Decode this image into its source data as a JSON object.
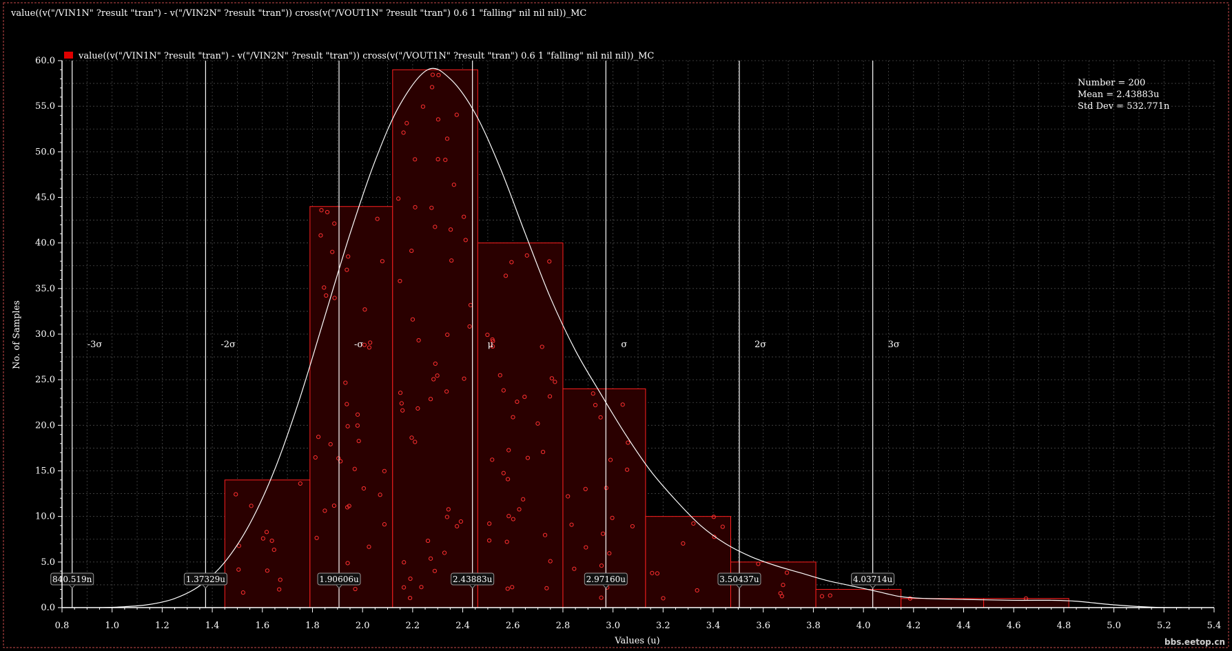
{
  "window": {
    "title": "value((v(\"/VIN1N\" ?result \"tran\") - v(\"/VIN2N\" ?result \"tran\")) cross(v(\"/VOUT1N\" ?result \"tran\") 0.6 1 \"falling\" nil nil nil))_MC"
  },
  "watermark": "bbs.eetop.cn",
  "colors": {
    "background": "#000000",
    "bar_fill": "#2a0000",
    "bar_stroke": "#ff2020",
    "dot": "#ff3030",
    "curve": "#ffffff",
    "grid": "#4a4a4a",
    "frame_dash": "#c84a4a"
  },
  "stats": {
    "number": "Number = 200",
    "mean": "Mean = 2.43883u",
    "std": "Std Dev = 532.771n"
  },
  "chart_data": {
    "type": "bar",
    "legend": "value((v(\"/VIN1N\" ?result \"tran\") - v(\"/VIN2N\" ?result \"tran\")) cross(v(\"/VOUT1N\" ?result \"tran\") 0.6 1 \"falling\" nil nil nil))_MC",
    "xlabel": "Values (u)",
    "ylabel": "No. of Samples",
    "xlim": [
      0.75,
      5.4
    ],
    "ylim": [
      0,
      60
    ],
    "xticks": [
      "0.8",
      "1.0",
      "1.2",
      "1.4",
      "1.6",
      "1.8",
      "2.0",
      "2.2",
      "2.4",
      "2.6",
      "2.8",
      "3.0",
      "3.2",
      "3.4",
      "3.6",
      "3.8",
      "4.0",
      "4.2",
      "4.4",
      "4.6",
      "4.8",
      "5.0",
      "5.2",
      "5.4"
    ],
    "yticks": [
      "0.0",
      "5.0",
      "10.0",
      "15.0",
      "20.0",
      "25.0",
      "30.0",
      "35.0",
      "40.0",
      "45.0",
      "50.0",
      "55.0",
      "60.0"
    ],
    "grid": true,
    "legend_position": "top-left",
    "bins": [
      {
        "x0": 1.45,
        "x1": 1.79,
        "count": 14
      },
      {
        "x0": 1.79,
        "x1": 2.12,
        "count": 44
      },
      {
        "x0": 2.12,
        "x1": 2.46,
        "count": 59
      },
      {
        "x0": 2.46,
        "x1": 2.8,
        "count": 40
      },
      {
        "x0": 2.8,
        "x1": 3.13,
        "count": 24
      },
      {
        "x0": 3.13,
        "x1": 3.47,
        "count": 10
      },
      {
        "x0": 3.47,
        "x1": 3.81,
        "count": 5
      },
      {
        "x0": 3.81,
        "x1": 4.15,
        "count": 2
      },
      {
        "x0": 4.15,
        "x1": 4.48,
        "count": 1
      },
      {
        "x0": 4.48,
        "x1": 4.82,
        "count": 1
      }
    ],
    "density_curve": [
      [
        0.95,
        0.0
      ],
      [
        1.05,
        0.1
      ],
      [
        1.15,
        0.35
      ],
      [
        1.25,
        1.0
      ],
      [
        1.35,
        2.4
      ],
      [
        1.45,
        5.0
      ],
      [
        1.55,
        9.2
      ],
      [
        1.65,
        15.2
      ],
      [
        1.75,
        23.0
      ],
      [
        1.85,
        32.0
      ],
      [
        1.95,
        41.0
      ],
      [
        2.05,
        49.0
      ],
      [
        2.15,
        55.2
      ],
      [
        2.26,
        59.0
      ],
      [
        2.35,
        58.0
      ],
      [
        2.45,
        54.2
      ],
      [
        2.55,
        48.2
      ],
      [
        2.65,
        41.0
      ],
      [
        2.75,
        34.0
      ],
      [
        2.85,
        28.2
      ],
      [
        2.95,
        23.5
      ],
      [
        3.05,
        19.0
      ],
      [
        3.15,
        15.0
      ],
      [
        3.25,
        11.8
      ],
      [
        3.35,
        9.0
      ],
      [
        3.45,
        7.0
      ],
      [
        3.55,
        5.6
      ],
      [
        3.65,
        4.6
      ],
      [
        3.75,
        3.8
      ],
      [
        3.85,
        3.0
      ],
      [
        3.95,
        2.4
      ],
      [
        4.05,
        1.8
      ],
      [
        4.15,
        1.2
      ],
      [
        4.25,
        1.0
      ],
      [
        4.4,
        0.9
      ],
      [
        4.6,
        0.8
      ],
      [
        4.75,
        0.8
      ],
      [
        4.85,
        0.7
      ],
      [
        5.0,
        0.3
      ],
      [
        5.15,
        0.05
      ],
      [
        5.27,
        0.0
      ]
    ],
    "sigma_lines": [
      {
        "label": "-3σ",
        "x": 0.840519,
        "value_label": "840.519n"
      },
      {
        "label": "-2σ",
        "x": 1.37329,
        "value_label": "1.37329u"
      },
      {
        "label": "-σ",
        "x": 1.90606,
        "value_label": "1.90606u"
      },
      {
        "label": "μ",
        "x": 2.43883,
        "value_label": "2.43883u"
      },
      {
        "label": "σ",
        "x": 2.9716,
        "value_label": "2.97160u"
      },
      {
        "label": "2σ",
        "x": 3.50437,
        "value_label": "3.50437u"
      },
      {
        "label": "3σ",
        "x": 4.03714,
        "value_label": "4.03714u"
      }
    ]
  }
}
